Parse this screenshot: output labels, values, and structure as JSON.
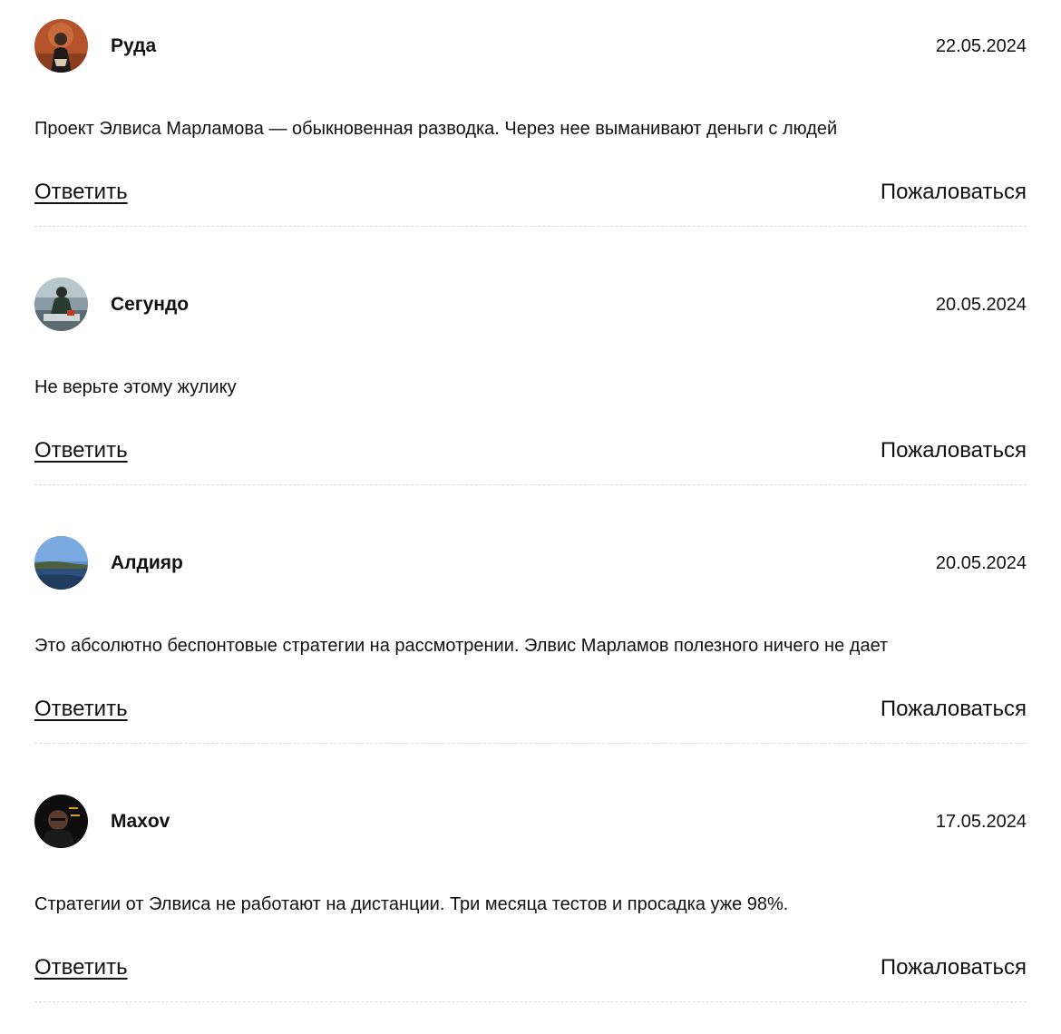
{
  "comments": [
    {
      "avatar_icon": "user-avatar-photo",
      "author": "Руда",
      "date": "22.05.2024",
      "text": "Проект Элвиса Марламова — обыкновенная разводка. Через нее выманивают деньги с людей",
      "reply_label": "Ответить",
      "report_label": "Пожаловаться"
    },
    {
      "avatar_icon": "user-avatar-photo",
      "author": "Сегундо",
      "date": "20.05.2024",
      "text": "Не верьте этому жулику",
      "reply_label": "Ответить",
      "report_label": "Пожаловаться"
    },
    {
      "avatar_icon": "user-avatar-photo",
      "author": "Алдияр",
      "date": "20.05.2024",
      "text": "Это абсолютно беспонтовые стратегии на рассмотрении. Элвис Марламов полезного ничего не дает",
      "reply_label": "Ответить",
      "report_label": "Пожаловаться"
    },
    {
      "avatar_icon": "user-avatar-photo",
      "author": "Maxov",
      "date": "17.05.2024",
      "text": "Стратегии от Элвиса не работают на дистанции. Три месяца тестов и просадка уже 98%.",
      "reply_label": "Ответить",
      "report_label": "Пожаловаться"
    }
  ]
}
